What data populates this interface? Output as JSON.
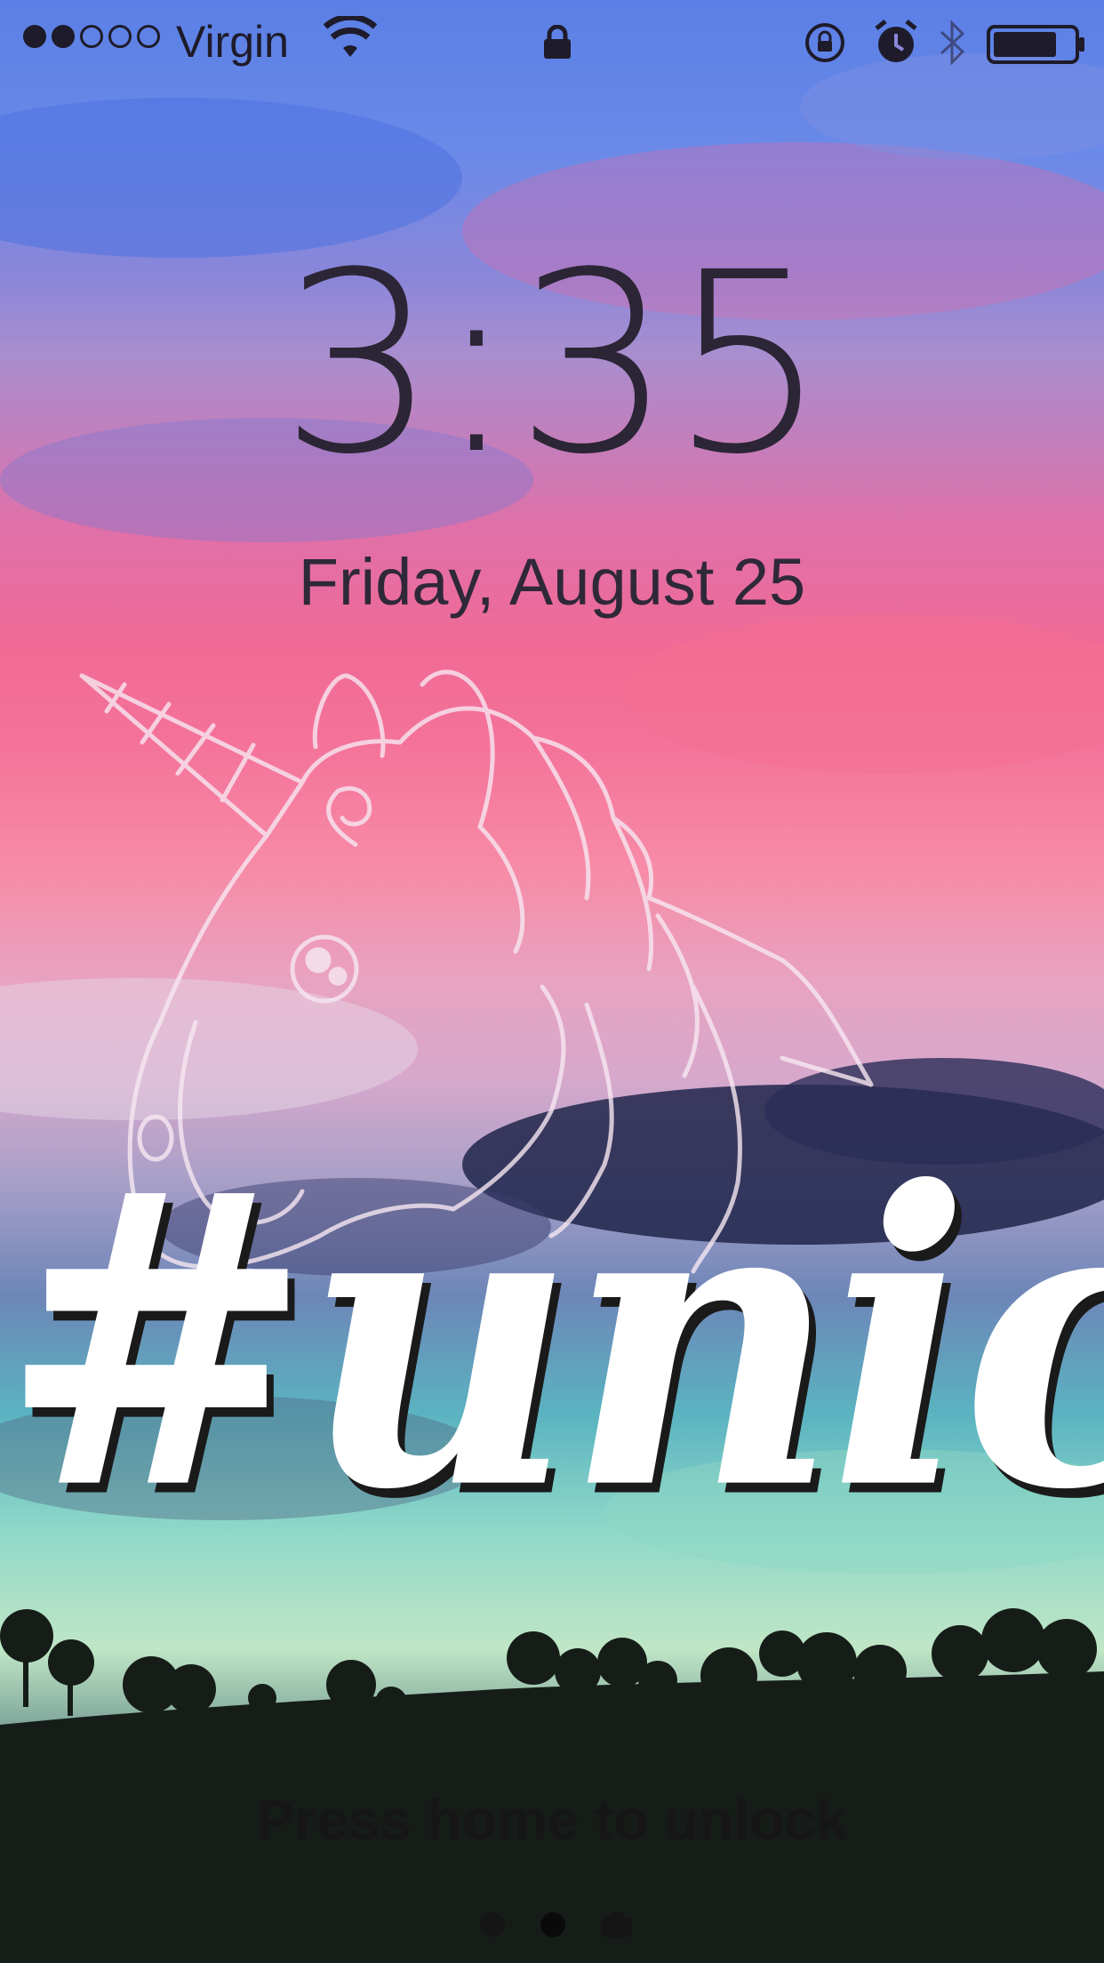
{
  "status_bar": {
    "carrier": "Virgin",
    "signal_bars_filled": 2,
    "signal_bars_total": 5,
    "icons": [
      "wifi-icon",
      "lock-icon",
      "rotation-lock-icon",
      "alarm-icon",
      "bluetooth-icon",
      "battery-icon"
    ],
    "battery_level": 0.8
  },
  "lockscreen": {
    "time": "3:35",
    "date": "Friday, August 25",
    "unlock_hint": "Press home to unlock"
  },
  "wallpaper": {
    "hashtag_text": "#unicorn",
    "icon": "unicorn-icon"
  },
  "pager": {
    "pages": 3,
    "active_index": 1,
    "last_icon": "camera-icon"
  },
  "colors": {
    "text_dark": "#2b2535",
    "hashtag": "#ffffff",
    "sky_top": "#5a7fe6",
    "sky_pink": "#f06a95",
    "sky_teal": "#5ab3c0",
    "ground": "#0b0c0d"
  }
}
